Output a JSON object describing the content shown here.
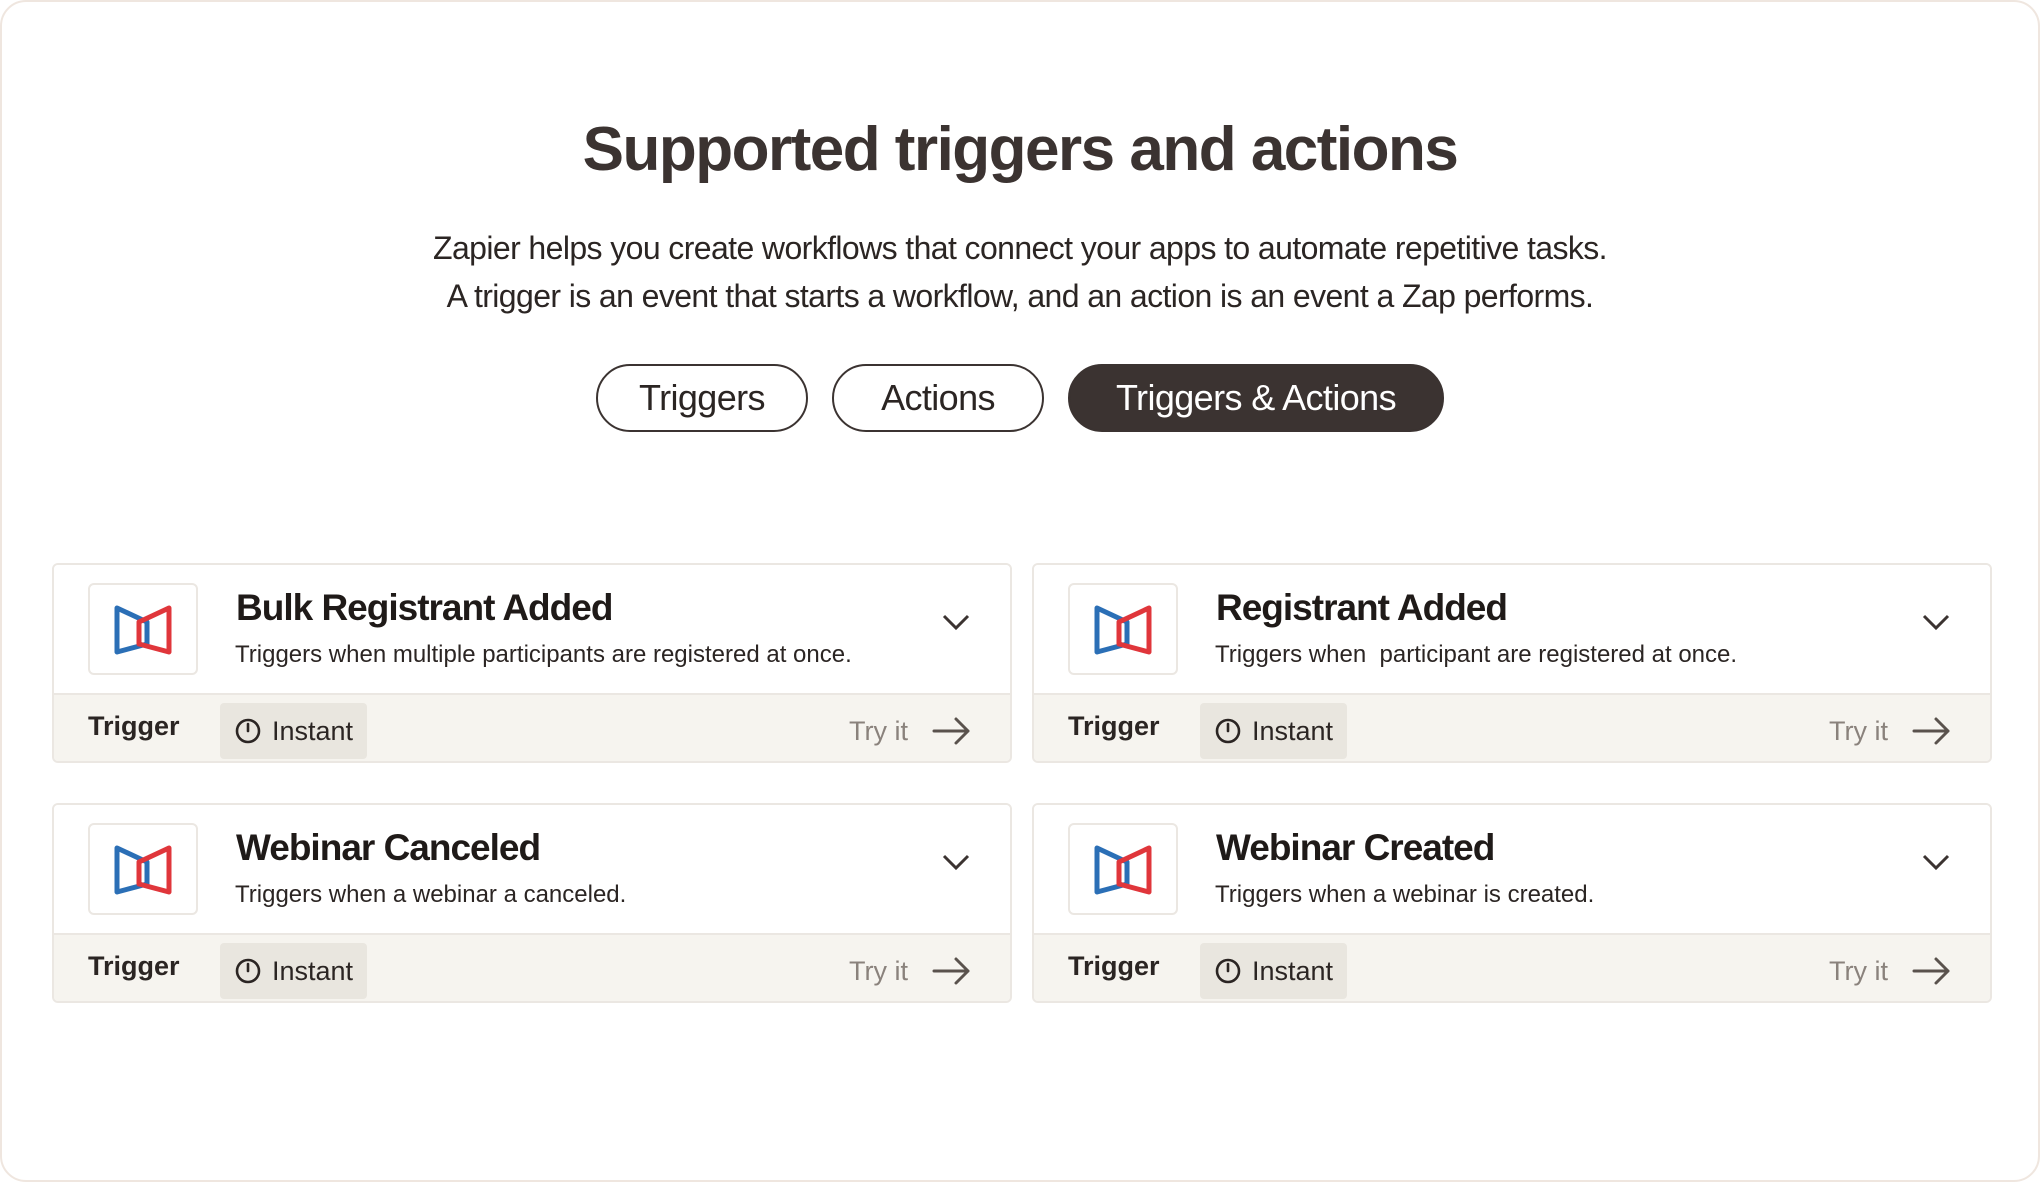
{
  "header": {
    "title": "Supported triggers and actions",
    "subtitle_line1": "Zapier helps you create workflows that connect your apps to automate repetitive tasks.",
    "subtitle_line2": "A trigger is an event that starts a workflow, and an action is an event a Zap performs."
  },
  "tabs": [
    {
      "label": "Triggers",
      "selected": false
    },
    {
      "label": "Actions",
      "selected": false
    },
    {
      "label": "Triggers & Actions",
      "selected": true
    }
  ],
  "cards": [
    {
      "title": "Bulk Registrant Added",
      "description": "Triggers when multiple participants are registered at once.",
      "type": "Trigger",
      "speed": "Instant",
      "cta": "Try it"
    },
    {
      "title": "Registrant Added",
      "description": "Triggers when  participant are registered at once.",
      "type": "Trigger",
      "speed": "Instant",
      "cta": "Try it"
    },
    {
      "title": "Webinar Canceled",
      "description": "Triggers when a webinar a canceled.",
      "type": "Trigger",
      "speed": "Instant",
      "cta": "Try it"
    },
    {
      "title": "Webinar Created",
      "description": "Triggers when a webinar is created.",
      "type": "Trigger",
      "speed": "Instant",
      "cta": "Try it"
    }
  ],
  "colors": {
    "logo_red": "#e0363b",
    "logo_blue": "#2b6fb6",
    "dark": "#3b3331",
    "footer_bg": "#f6f4ef"
  }
}
